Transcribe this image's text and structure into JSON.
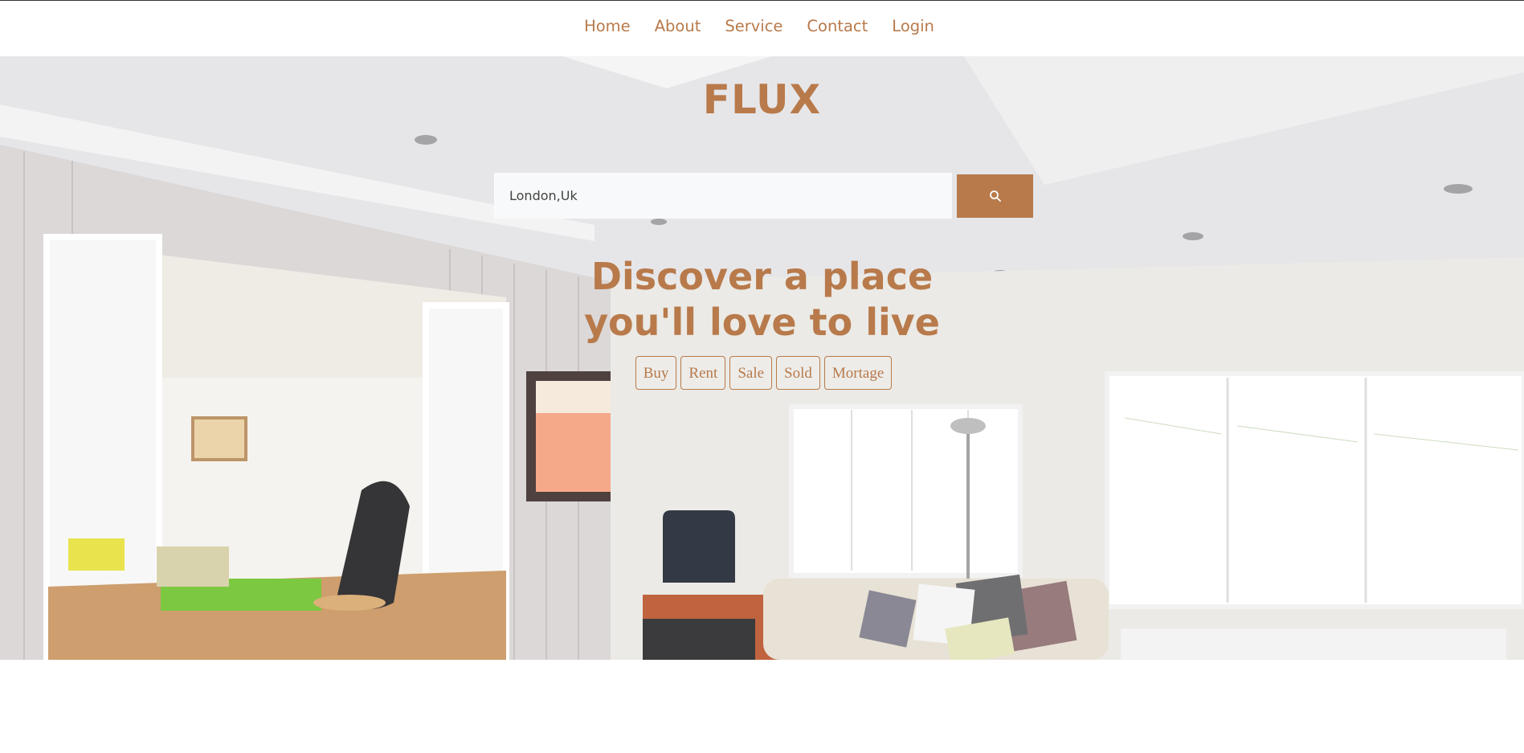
{
  "nav": {
    "links": [
      "Home",
      "About",
      "Service",
      "Contact",
      "Login"
    ]
  },
  "hero": {
    "brand": "FLUX",
    "search": {
      "value": "London,Uk",
      "button_icon": "search-icon"
    },
    "headline_line1": "Discover a place",
    "headline_line2": "you'll love to live",
    "filters": [
      "Buy",
      "Rent",
      "Sale",
      "Sold",
      "Mortage"
    ]
  },
  "colors": {
    "accent": "#b87a4b",
    "nav_bg": "#ffffff",
    "search_bg": "#f8f9fa"
  }
}
